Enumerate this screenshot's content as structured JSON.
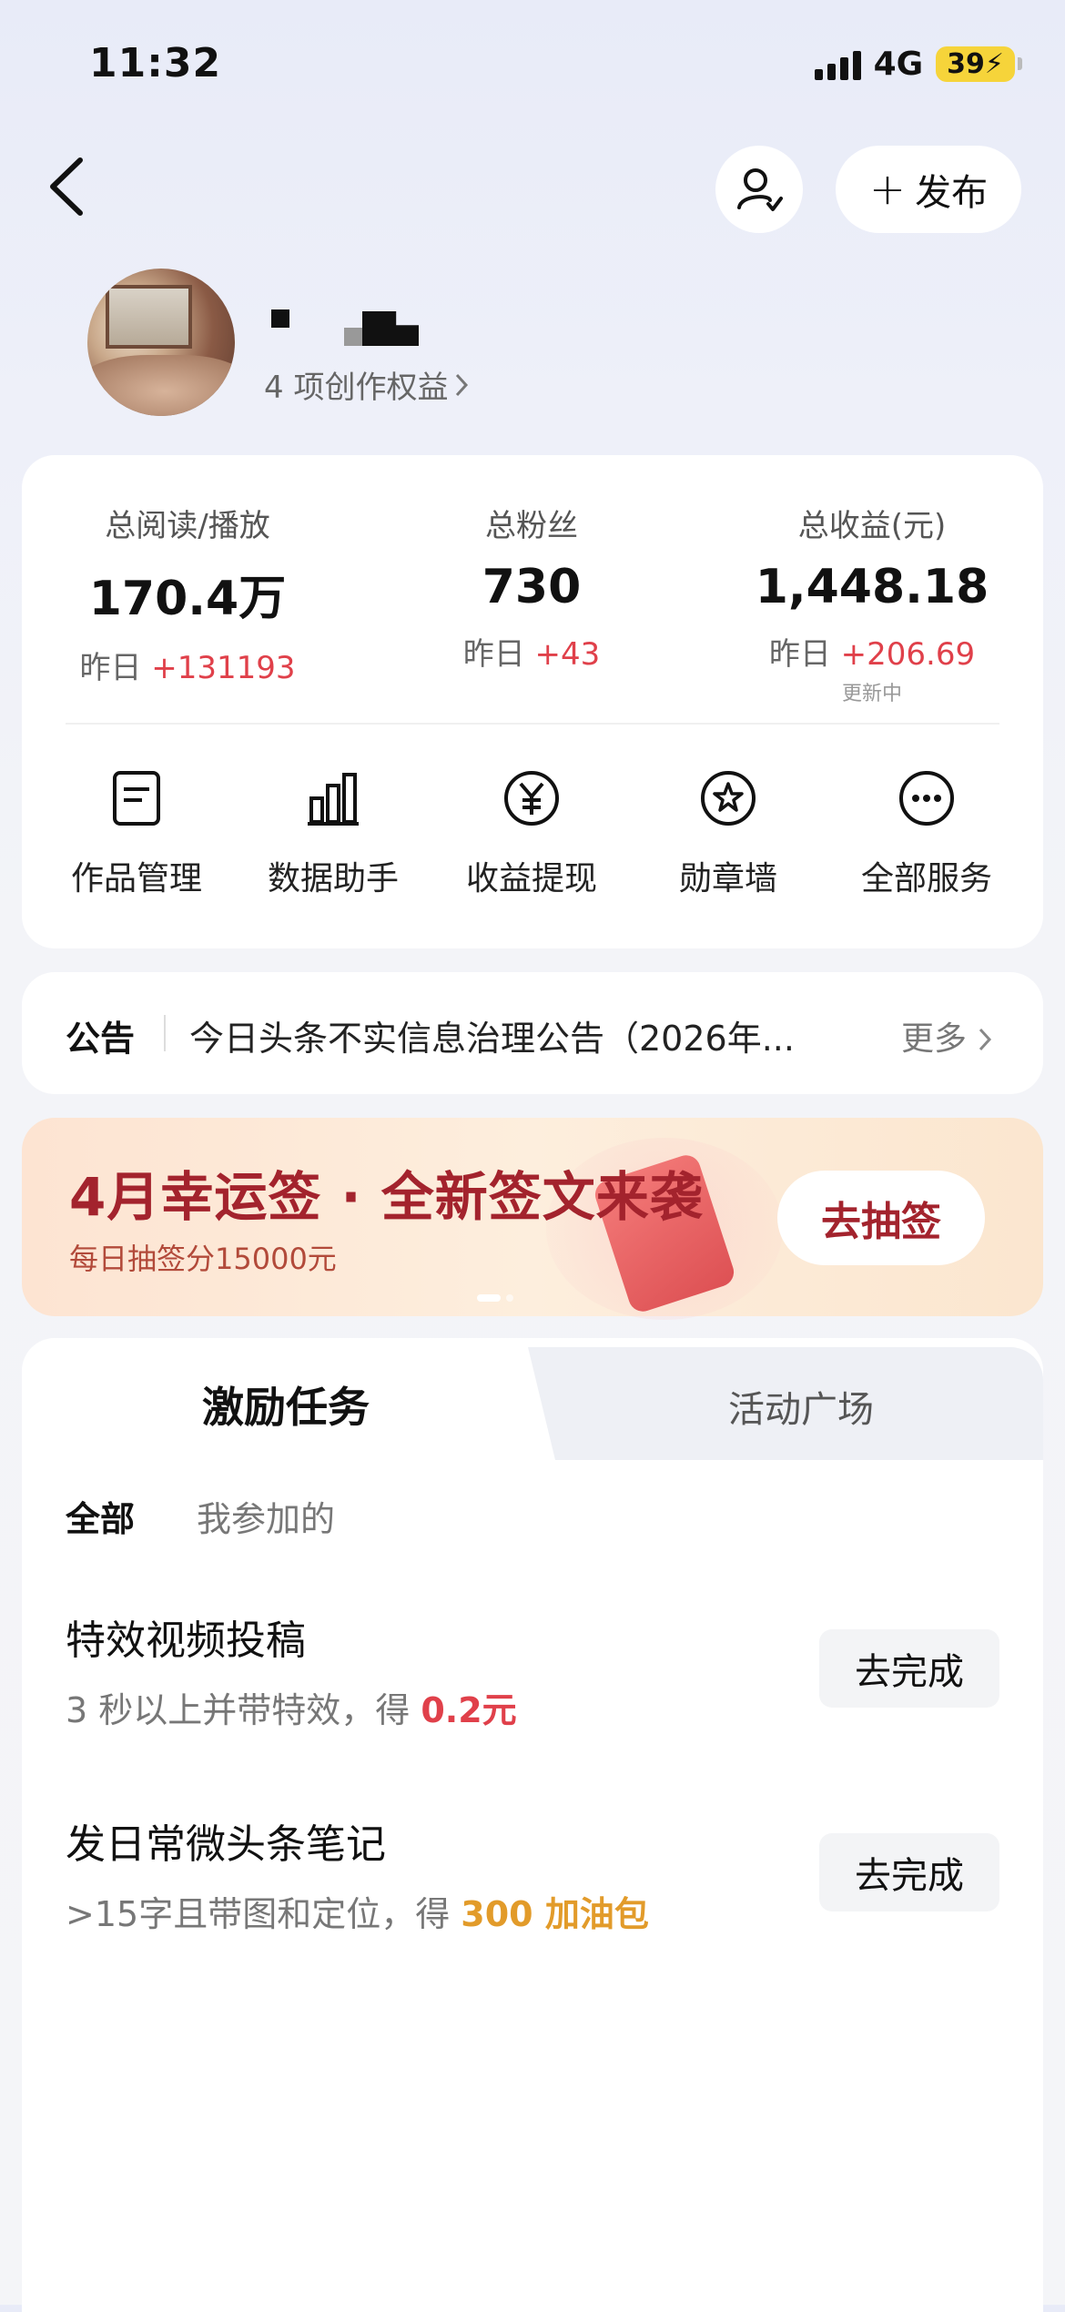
{
  "status_bar": {
    "time": "11:32",
    "network": "4G",
    "battery": "39"
  },
  "nav": {
    "publish_label": "发布"
  },
  "profile": {
    "rights_link": "4 项创作权益"
  },
  "stats": [
    {
      "label": "总阅读/播放",
      "value": "170.4万",
      "yesterday_prefix": "昨日",
      "yesterday_delta": "+131193"
    },
    {
      "label": "总粉丝",
      "value": "730",
      "yesterday_prefix": "昨日",
      "yesterday_delta": "+43"
    },
    {
      "label": "总收益(元)",
      "value": "1,448.18",
      "yesterday_prefix": "昨日",
      "yesterday_delta": "+206.69",
      "note": "更新中"
    }
  ],
  "services": [
    {
      "label": "作品管理",
      "icon": "document-icon"
    },
    {
      "label": "数据助手",
      "icon": "bar-chart-icon"
    },
    {
      "label": "收益提现",
      "icon": "yuan-coin-icon"
    },
    {
      "label": "勋章墙",
      "icon": "medal-icon"
    },
    {
      "label": "全部服务",
      "icon": "more-dots-icon"
    }
  ],
  "notice": {
    "tag": "公告",
    "text": "今日头条不实信息治理公告（2026年...",
    "more": "更多"
  },
  "banner": {
    "title": "4月幸运签 · 全新签文来袭",
    "subtitle": "每日抽签分15000元",
    "button": "去抽签"
  },
  "tabs": {
    "active": "激励任务",
    "inactive": "活动广场"
  },
  "filters": {
    "all": "全部",
    "mine": "我参加的"
  },
  "tasks": [
    {
      "title": "特效视频投稿",
      "desc_prefix": "3 秒以上并带特效，得 ",
      "reward": "0.2元",
      "button": "去完成"
    },
    {
      "title": "发日常微头条笔记",
      "desc_prefix": ">15字且带图和定位，得 ",
      "reward": "300 加油包",
      "button": "去完成"
    }
  ],
  "colors": {
    "accent_red": "#e0404a",
    "banner_red": "#a3232d",
    "reward_gold": "#e29b2a"
  }
}
